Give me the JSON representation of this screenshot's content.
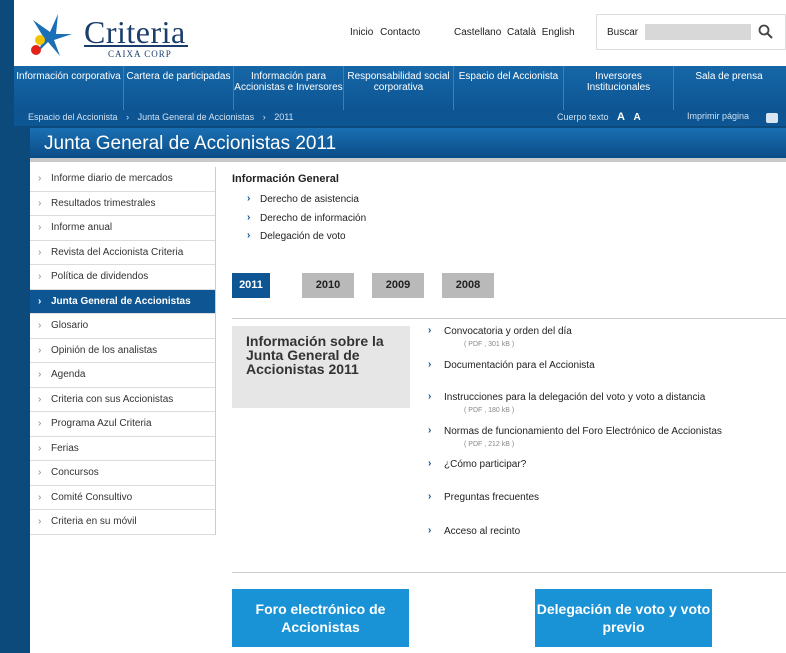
{
  "brand": {
    "name": "Criteria",
    "subtitle": "CAIXA CORP"
  },
  "top_links": [
    "Inicio",
    "Contacto"
  ],
  "languages": [
    "Castellano",
    "Català",
    "English"
  ],
  "search": {
    "label": "Buscar",
    "placeholder": ""
  },
  "nav": [
    "Información corporativa",
    "Cartera de participadas",
    "Información para Accionistas e Inversores",
    "Responsabilidad social corporativa",
    "Espacio del Accionista",
    "Inversores Institucionales",
    "Sala de prensa"
  ],
  "breadcrumb": [
    "Espacio del Accionista",
    "Junta General de Accionistas",
    "2011"
  ],
  "text_size_label": "Cuerpo texto",
  "text_size_buttons": [
    "A",
    "A"
  ],
  "print_label": "Imprimir página",
  "page_title": "Junta General de Accionistas 2011",
  "sidebar": [
    {
      "label": "Informe diario de mercados"
    },
    {
      "label": "Resultados trimestrales"
    },
    {
      "label": "Informe anual"
    },
    {
      "label": "Revista del Accionista Criteria"
    },
    {
      "label": "Política de dividendos"
    },
    {
      "label": "Junta General de Accionistas"
    },
    {
      "label": "Glosario"
    },
    {
      "label": "Opinión de los analistas"
    },
    {
      "label": "Agenda"
    },
    {
      "label": "Criteria con sus Accionistas"
    },
    {
      "label": "Programa Azul Criteria"
    },
    {
      "label": "Ferias"
    },
    {
      "label": "Concursos"
    },
    {
      "label": "Comité Consultivo"
    },
    {
      "label": "Criteria en su móvil"
    }
  ],
  "general": {
    "title": "Información General",
    "links": [
      "Derecho de asistencia",
      "Derecho de información",
      "Delegación de voto"
    ]
  },
  "years": [
    "2011",
    "2010",
    "2009",
    "2008"
  ],
  "info_box_title": "Información sobre la Junta General de Accionistas 2011",
  "documents": [
    {
      "label": "Convocatoria y orden del día",
      "meta": "( PDF , 301 kB )"
    },
    {
      "label": "Documentación para el Accionista",
      "meta": ""
    },
    {
      "label": "Instrucciones para la delegación del voto y voto a distancia",
      "meta": "( PDF , 180 kB )"
    },
    {
      "label": "Normas de funcionamiento del Foro Electrónico de Accionistas",
      "meta": "( PDF , 212 kB )"
    },
    {
      "label": "¿Cómo participar?",
      "meta": ""
    },
    {
      "label": "Preguntas frecuentes",
      "meta": ""
    },
    {
      "label": "Acceso al recinto",
      "meta": ""
    }
  ],
  "buttons": {
    "forum": "Foro electrónico de Accionistas",
    "vote": "Delegación de voto y voto previo"
  },
  "colors": {
    "brand_blue": "#0d5593",
    "accent_blue": "#1a93d6",
    "year_inactive": "#b9b9b9"
  }
}
